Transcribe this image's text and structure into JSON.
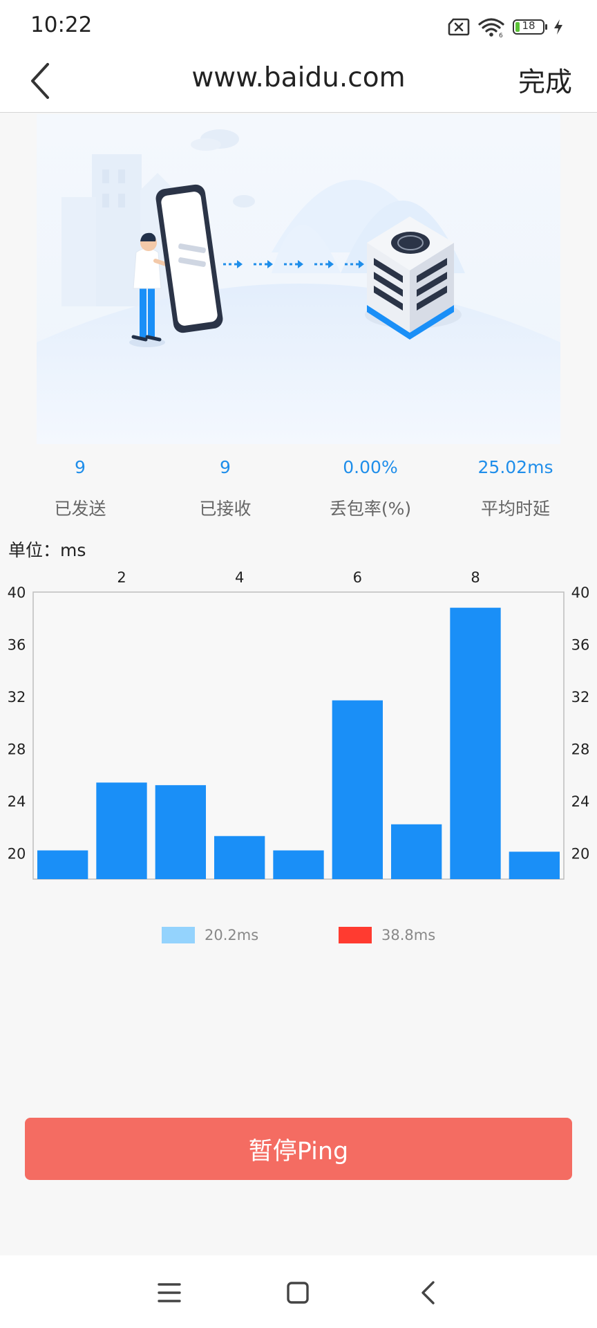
{
  "status_bar": {
    "time": "10:22",
    "battery_level": "18"
  },
  "navbar": {
    "title": "www.baidu.com",
    "done_label": "完成"
  },
  "stats": [
    {
      "value": "9",
      "label": "已发送"
    },
    {
      "value": "9",
      "label": "已接收"
    },
    {
      "value": "0.00%",
      "label": "丢包率(%)"
    },
    {
      "value": "25.02ms",
      "label": "平均时延"
    }
  ],
  "unit_label": "单位：ms",
  "colors": {
    "accent": "#1f8eea",
    "bar": "#1a8ff7",
    "min": "#94d3fd",
    "max": "#ff3b30",
    "button": "#f46c62"
  },
  "chart_data": {
    "type": "bar",
    "x": [
      1,
      2,
      3,
      4,
      5,
      6,
      7,
      8,
      9
    ],
    "values": [
      20.2,
      25.4,
      25.2,
      21.3,
      20.2,
      31.7,
      22.2,
      38.8,
      20.1
    ],
    "ylim": [
      18,
      40
    ],
    "yticks": [
      20,
      24,
      28,
      32,
      36,
      40
    ],
    "xticks": [
      2,
      4,
      6,
      8
    ],
    "legend": [
      {
        "label": "20.2ms",
        "color": "#94d3fd"
      },
      {
        "label": "38.8ms",
        "color": "#ff3b30"
      }
    ]
  },
  "pause_button_label": "暂停Ping"
}
